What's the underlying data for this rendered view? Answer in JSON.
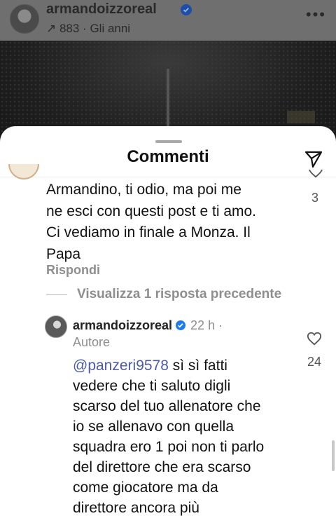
{
  "post": {
    "username": "armandoizzoreal",
    "subtitle": "↗ 883 · Gli anni",
    "menu": "•••"
  },
  "sheet": {
    "title": "Commenti"
  },
  "comment1": {
    "lines": [
      "Armandino,  ti odio, ma poi me",
      "ne esci con questi post e ti amo.",
      "Ci vediamo in finale a Monza. Il",
      "Papa"
    ],
    "reply_label": "Rispondi",
    "likes": "3"
  },
  "view_replies": {
    "label": "Visualizza 1 risposta precedente"
  },
  "comment2": {
    "username": "armandoizzoreal",
    "time": " 22 h · ",
    "role": "Autore",
    "mention": "@panzeri9578",
    "first_line_rest": " sì sì fatti",
    "lines": [
      "vedere che ti saluto digli",
      "scarso del tuo allenatore che",
      "io se allenavo con quella",
      "squadra ero 1 poi non ti parlo",
      "del direttore che era scarso",
      "come giocatore ma da",
      "direttore ancora più"
    ],
    "likes": "24"
  },
  "colors": {
    "verified_badge": "#1d7bf0",
    "mention": "#4b5aa8",
    "muted_text": "#8e8e8e"
  },
  "icons": {
    "share": "paper-plane-icon",
    "like": "heart-icon",
    "verified": "verified-badge-icon"
  }
}
